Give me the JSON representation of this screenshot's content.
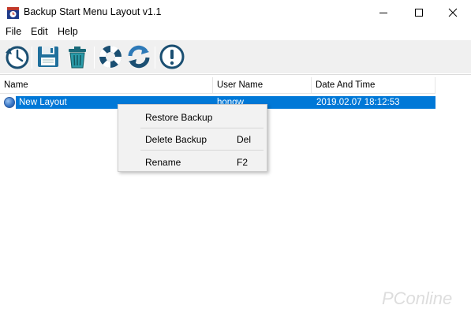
{
  "window": {
    "title": "Backup Start Menu Layout v1.1"
  },
  "menubar": {
    "file": "File",
    "edit": "Edit",
    "help": "Help"
  },
  "toolbar": {
    "icons": [
      "restore-clock-icon",
      "save-floppy-icon",
      "recycle-bin-icon",
      "lifebuoy-icon",
      "refresh-icon",
      "alert-icon"
    ]
  },
  "list": {
    "columns": [
      "Name",
      "User Name",
      "Date And Time"
    ],
    "rows": [
      {
        "name": "New Layout",
        "user": "hongw",
        "date": "2019.02.07 18:12:53",
        "selected": true
      }
    ]
  },
  "context_menu": {
    "items": [
      {
        "label": "Restore Backup",
        "shortcut": ""
      },
      {
        "label": "Delete Backup",
        "shortcut": "Del"
      },
      {
        "label": "Rename",
        "shortcut": "F2"
      }
    ]
  },
  "watermark": {
    "text": "PConline"
  },
  "colors": {
    "selection": "#0078d7",
    "toolbar_bg": "#f0f0f0",
    "menu_bg": "#f2f2f2"
  }
}
